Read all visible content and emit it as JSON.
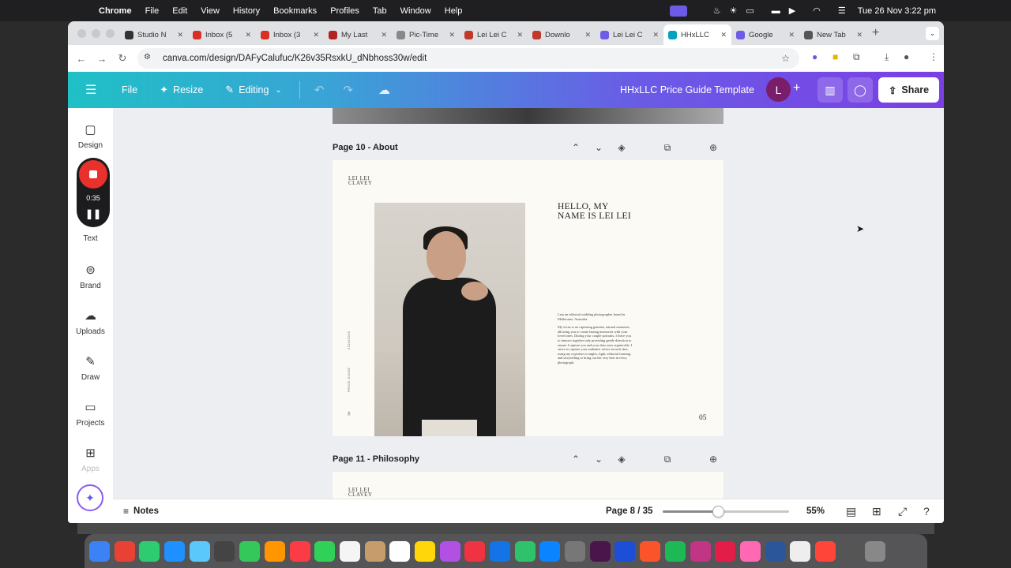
{
  "menubar": {
    "items": [
      "Chrome",
      "File",
      "Edit",
      "View",
      "History",
      "Bookmarks",
      "Profiles",
      "Tab",
      "Window",
      "Help"
    ],
    "clock": "Tue 26 Nov  3:22 pm"
  },
  "browser": {
    "tabs": [
      {
        "title": "Studio N",
        "color": "#333333"
      },
      {
        "title": "Inbox (5",
        "color": "#d93025"
      },
      {
        "title": "Inbox (3",
        "color": "#d93025"
      },
      {
        "title": "My Last",
        "color": "#b22222"
      },
      {
        "title": "Pic-Time",
        "color": "#888888"
      },
      {
        "title": "Lei Lei C",
        "color": "#c0392b"
      },
      {
        "title": "Downlo",
        "color": "#c0392b"
      },
      {
        "title": "Lei Lei C",
        "color": "#6c5ce7"
      },
      {
        "title": "HHxLLC",
        "color": "#00a3bf",
        "active": true
      },
      {
        "title": "Google",
        "color": "#6c5ce7"
      },
      {
        "title": "New Tab",
        "color": "#555555"
      }
    ],
    "url": "canva.com/design/DAFyCalufuc/K26v35RsxkU_dNbhoss30w/edit"
  },
  "canva": {
    "file_label": "File",
    "resize_label": "Resize",
    "editing_label": "Editing",
    "design_title": "HHxLLC Price Guide Template",
    "avatar_initial": "L",
    "share_label": "Share",
    "brand_gradient": [
      "#1fc0c6",
      "#7b3fe4"
    ]
  },
  "sidebar": {
    "items": [
      {
        "label": "Design",
        "icon": "design-icon"
      },
      {
        "label": "Text",
        "icon": "text-icon"
      },
      {
        "label": "Brand",
        "icon": "brand-icon"
      },
      {
        "label": "Uploads",
        "icon": "uploads-icon"
      },
      {
        "label": "Draw",
        "icon": "draw-icon"
      },
      {
        "label": "Projects",
        "icon": "projects-icon"
      },
      {
        "label": "Apps",
        "icon": "apps-icon"
      }
    ],
    "recorder_time": "0:35"
  },
  "pages": {
    "about": {
      "label": "Page 10 - About",
      "logo_line1": "LEI LEI",
      "logo_line2": "CLAVEY",
      "heading_line1": "HELLO, MY",
      "heading_line2": "NAME IS LEI LEI",
      "bio_p1": "I am an editorial wedding photographer based in Melbourne, Australia.",
      "bio_p2": "My focus is on capturing genuine, natural moments, allowing you to create lasting memories with your loved ones. During your couple portraits, I leave you to interact together only providing gentle direction to ensure I capture you and your dear ones organically. I strive to capture your authentic selves in each shot, using my expertise in angles, light, editorial framing, and storytelling to bring out the very best in every photograph.",
      "vertical_year": "2024/2025",
      "vertical_title": "PRICE GUIDE",
      "page_number": "05"
    },
    "philosophy": {
      "label": "Page 11 - Philosophy",
      "logo_line1": "LEI LEI",
      "logo_line2": "CLAVEY"
    }
  },
  "footer": {
    "notes_label": "Notes",
    "page_indicator": "Page 8 / 35",
    "zoom": "55%",
    "zoom_fraction": 0.44
  }
}
